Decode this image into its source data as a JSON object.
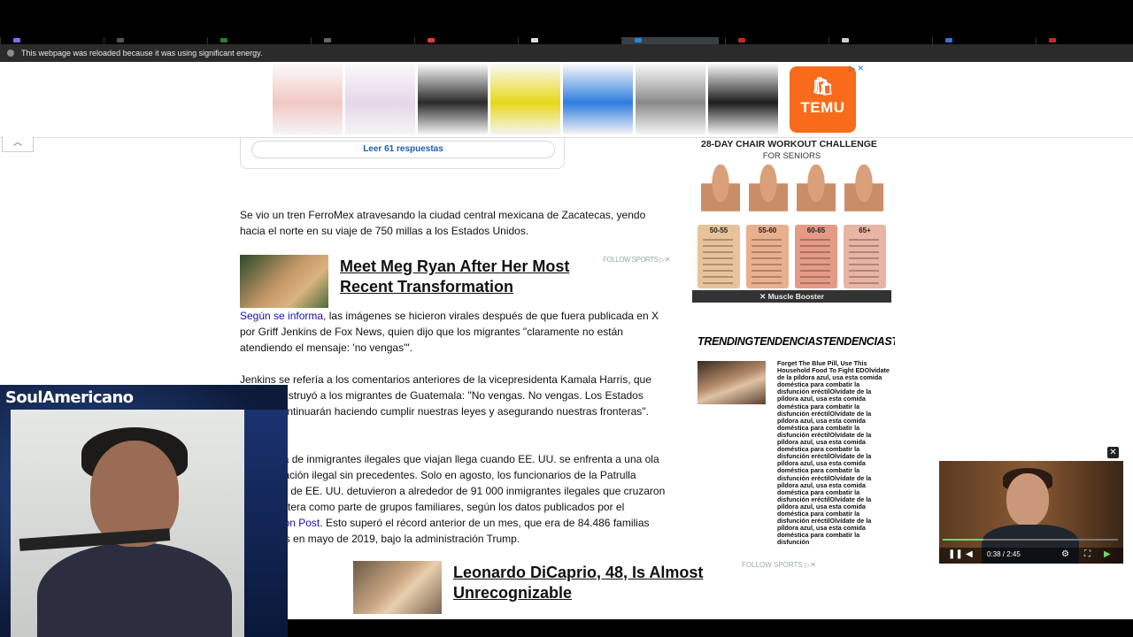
{
  "browser": {
    "tabs": [
      {
        "color": "#7b6cff"
      },
      {
        "color": "#555555"
      },
      {
        "color": "#2e7d32"
      },
      {
        "color": "#666666"
      },
      {
        "color": "#e53935"
      },
      {
        "color": "#dddddd"
      },
      {
        "color": "#1e88e5",
        "active": true
      },
      {
        "color": "#c62828"
      },
      {
        "color": "#cccccc"
      },
      {
        "color": "#3d6fd8"
      },
      {
        "color": "#c62828"
      }
    ],
    "infobar_text": "This webpage was reloaded because it was using significant energy."
  },
  "top_ad": {
    "brand": "TEMU",
    "ad_choices": "▷ ✕",
    "product_colors": [
      "#f1c8c4",
      "#e6d6ea",
      "#2a2a2a",
      "#e8d81a",
      "#2f7de0",
      "#8a8a8a",
      "#1c1c1c"
    ]
  },
  "comments_card": {
    "button": "Leer 61 respuestas"
  },
  "article": {
    "p1": "Se vio un tren FerroMex atravesando la ciudad central mexicana de Zacatecas, yendo hacia el norte en su viaje de 750 millas a los Estados Unidos.",
    "p2_link": "Según se informa,",
    "p2_rest": " las imágenes se hicieron virales después de que fuera publicada en X por Griff Jenkins de Fox News, quien dijo que los migrantes \"claramente no están atendiendo el mensaje: 'no vengas'\".",
    "p3": "Jenkins se refería a los comentarios anteriores de la vicepresidenta Kamala Harris, que en junio instruyó a los migrantes de Guatemala: \"No vengas. No vengas. Los Estados Unidos continuarán haciendo cumplir nuestras leyes y asegurando nuestras fronteras\".",
    "p4_a": "La llegada de inmigrantes ilegales que viajan llega cuando EE. UU. se enfrenta a una ola de inmigración ilegal sin precedentes. Solo en agosto, los funcionarios de la Patrulla Fronteriza de EE. UU. detuvieron a alrededor de 91 000 inmigrantes ilegales que cruzaron por la frontera como parte de grupos familiares, según los datos publicados por el ",
    "p4_link": "Washington Post",
    "p4_b": ". Esto superó el récord anterior de un mes, que era de 84.486 familias arrestadas en mayo de 2019, bajo la administración Trump."
  },
  "inline_promo": {
    "headline": "Meet Meg Ryan After Her Most Recent Transformation",
    "source": "FOLLOW SPORTS ▷✕"
  },
  "side_ad": {
    "title": "28-DAY CHAIR WORKOUT CHALLENGE",
    "subtitle": "FOR SENIORS",
    "ages": [
      "50-55",
      "55-60",
      "60-65",
      "65+"
    ],
    "age_colors": [
      "#e9c29a",
      "#eab08e",
      "#e59a86",
      "#e8b4a4"
    ],
    "footer": "✕ Muscle Booster"
  },
  "trending": {
    "title": "TRENDINGTENDENCIASTENDENCIASTENDENCIASTENDENCIASTENDENCIAS",
    "headline": "Forget The Blue Pill, Use This Household Food To Fight EDOlvídate de la píldora azul, usa esta comida doméstica para combatir la disfunción eréctilOlvídate de la píldora azul, usa esta comida doméstica para combatir la disfunción eréctilOlvídate de la píldora azul, usa esta comida doméstica para combatir la disfunción eréctilOlvídate de la píldora azul, usa esta comida doméstica para combatir la disfunción eréctilOlvídate de la píldora azul, usa esta comida doméstica para combatir la disfunción eréctilOlvídate de la píldora azul, usa esta comida doméstica para combatir la disfunción eréctilOlvídate de la píldora azul, usa esta comida doméstica para combatir la disfunción eréctilOlvídate de la píldora azul, usa esta comida doméstica para combatir la disfunción"
  },
  "bottom_ad": {
    "headline": "Leonardo DiCaprio, 48, Is Almost Unrecognizable",
    "source": "FOLLOW SPORTS ▷✕"
  },
  "webcam": {
    "streamer_name": "SoulAmericano"
  },
  "pip_player": {
    "time": "0:38 / 2:45",
    "progress_fraction": 0.23
  }
}
